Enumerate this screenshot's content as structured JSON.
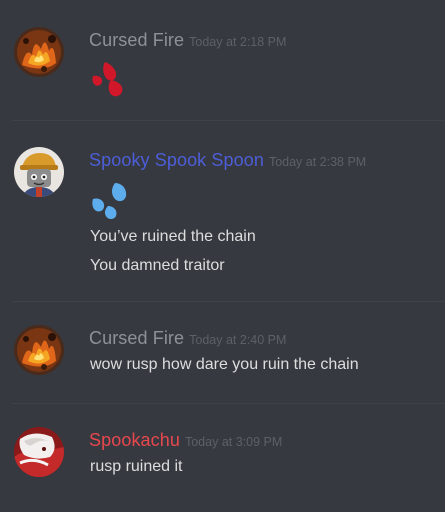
{
  "messages": [
    {
      "author": "Cursed Fire",
      "author_color": "#8e9297",
      "timestamp": "Today at 2:18 PM",
      "avatar": "fire-avatar",
      "lines": [],
      "emoji": "drops-emoji-red"
    },
    {
      "author": "Spooky Spook Spoon",
      "author_color": "#4d5ed8",
      "timestamp": "Today at 2:38 PM",
      "avatar": "cartoon-character-avatar",
      "lines": [
        "You’ve ruined the chain",
        "You damned traitor"
      ],
      "emoji": "sweat-drops-emoji"
    },
    {
      "author": "Cursed Fire",
      "author_color": "#8e9297",
      "timestamp": "Today at 2:40 PM",
      "avatar": "fire-avatar",
      "lines": [
        "wow rusp how dare you ruin the chain"
      ]
    },
    {
      "author": "Spookachu",
      "author_color": "#e8474e",
      "timestamp": "Today at 3:09 PM",
      "avatar": "anime-character-avatar",
      "lines": [
        "rusp ruined it"
      ]
    }
  ],
  "colors": {
    "background": "#36393f",
    "text": "#dcddde",
    "timestamp": "#5d6067",
    "divider": "#3f4248",
    "red_drops": "#d0182a",
    "blue_drops": "#5dadec"
  }
}
